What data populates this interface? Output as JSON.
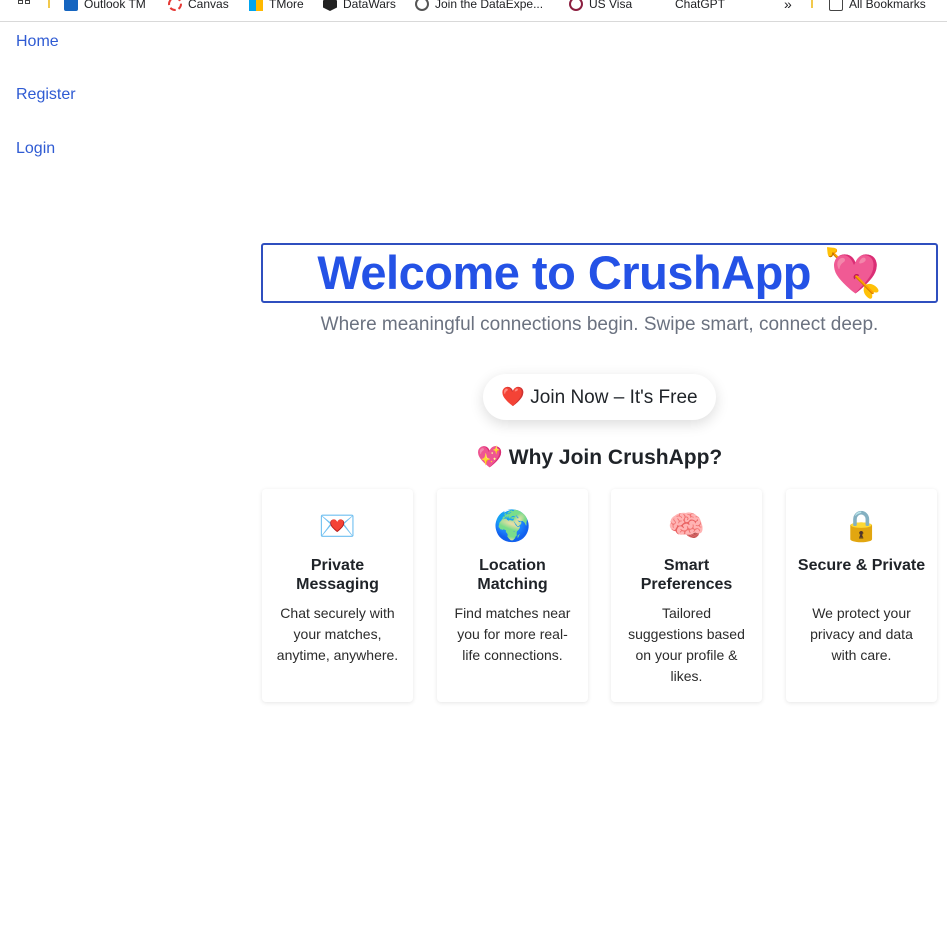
{
  "bookmarks": {
    "items": [
      {
        "label": "Outlook TM",
        "icon": "outlook-icon",
        "color": "#1565c0"
      },
      {
        "label": "Canvas",
        "icon": "canvas-icon",
        "color": "#e53935"
      },
      {
        "label": "TMore",
        "icon": "windows-icon",
        "color": "#f25022"
      },
      {
        "label": "DataWars",
        "icon": "datawars-icon",
        "color": "#222222"
      },
      {
        "label": "Join the DataExpe...",
        "icon": "dataexpert-icon",
        "color": "#555555"
      },
      {
        "label": "US Visa",
        "icon": "us-visa-icon",
        "color": "#8b1e3f"
      },
      {
        "label": "ChatGPT",
        "icon": "chatgpt-icon",
        "color": "#444444"
      }
    ],
    "overflow_label": "»",
    "all_bookmarks_label": "All Bookmarks"
  },
  "nav": {
    "home": "Home",
    "register": "Register",
    "login": "Login"
  },
  "hero": {
    "title": "Welcome to CrushApp 💘",
    "subtitle": "Where meaningful connections begin. Swipe smart, connect deep.",
    "cta": "❤️ Join Now – It's Free"
  },
  "why": {
    "title": "💖 Why Join CrushApp?"
  },
  "features": [
    {
      "icon": "💌",
      "title": "Private Messaging",
      "desc": "Chat securely with your matches, anytime, anywhere."
    },
    {
      "icon": "🌍",
      "title": "Location Matching",
      "desc": "Find matches near you for more real-life connections."
    },
    {
      "icon": "🧠",
      "title": "Smart Preferences",
      "desc": "Tailored suggestions based on your profile & likes."
    },
    {
      "icon": "🔒",
      "title": "Secure & Private",
      "desc": "We protect your privacy and data with care."
    }
  ],
  "colors": {
    "link": "#2f5bd3",
    "title": "#2452e6",
    "title_border": "#2f4fbf",
    "subtitle": "#6b7280"
  }
}
